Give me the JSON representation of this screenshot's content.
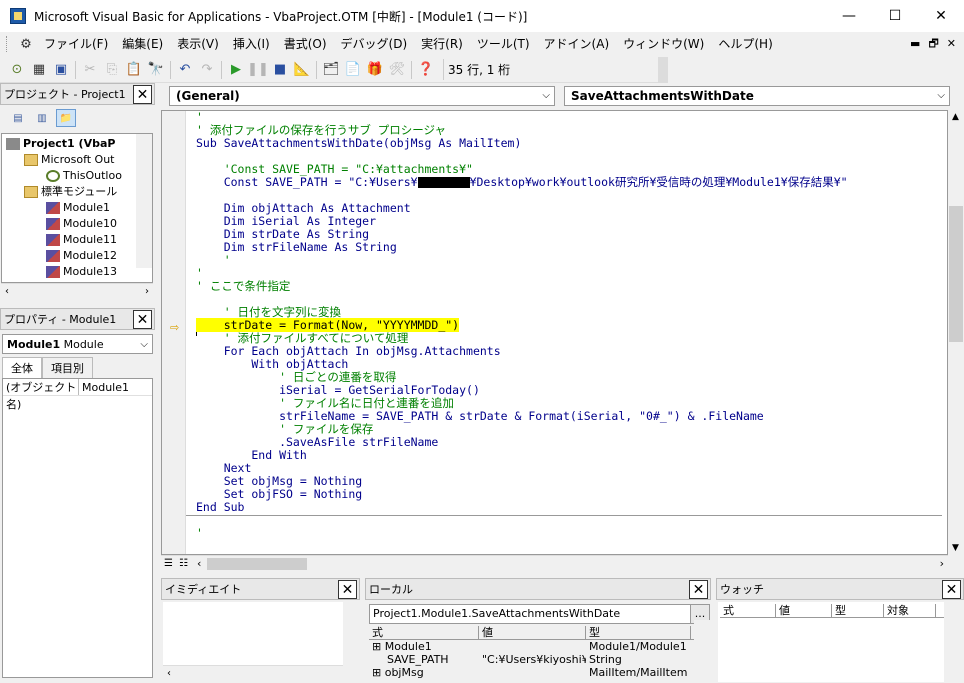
{
  "window": {
    "title": "Microsoft Visual Basic for Applications - VbaProject.OTM [中断] - [Module1 (コード)]",
    "min": "—",
    "max": "☐",
    "close": "✕"
  },
  "menu": [
    "ファイル(F)",
    "編集(E)",
    "表示(V)",
    "挿入(I)",
    "書式(O)",
    "デバッグ(D)",
    "実行(R)",
    "ツール(T)",
    "アドイン(A)",
    "ウィンドウ(W)",
    "ヘルプ(H)"
  ],
  "mdi": {
    "min": "▬",
    "restore": "🗗",
    "close": "✕"
  },
  "toolbar": {
    "position": "35 行, 1 桁"
  },
  "project": {
    "title": "プロジェクト - Project1",
    "tree": [
      "Project1 (VbaP",
      "Microsoft Out",
      "ThisOutloo",
      "標準モジュール",
      "Module1",
      "Module10",
      "Module11",
      "Module12",
      "Module13"
    ]
  },
  "properties": {
    "title": "プロパティ - Module1",
    "object": "Module1",
    "object_type": "Module",
    "tabs": [
      "全体",
      "項目別"
    ],
    "rows": [
      {
        "name": "(オブジェクト名)",
        "value": "Module1"
      }
    ]
  },
  "code": {
    "object_combo": "(General)",
    "proc_combo": "SaveAttachmentsWithDate",
    "lines": [
      {
        "t": "'",
        "c": "cm"
      },
      {
        "t": "' 添付ファイルの保存を行うサブ プロシージャ",
        "c": "cm"
      },
      {
        "t": "Sub SaveAttachmentsWithDate(objMsg As MailItem)",
        "c": "kw"
      },
      {
        "t": "",
        "c": ""
      },
      {
        "t": "    'Const SAVE_PATH = \"C:¥attachments¥\"",
        "c": "cm"
      },
      {
        "t": "    Const SAVE_PATH = \"C:¥Users¥",
        "c": "kw",
        "redact": true,
        "tail": "¥Desktop¥work¥outlook研究所¥受信時の処理¥Module1¥保存結果¥\""
      },
      {
        "t": "",
        "c": ""
      },
      {
        "t": "    Dim objAttach As Attachment",
        "c": "kw"
      },
      {
        "t": "    Dim iSerial As Integer",
        "c": "kw"
      },
      {
        "t": "    Dim strDate As String",
        "c": "kw"
      },
      {
        "t": "    Dim strFileName As String",
        "c": "kw"
      },
      {
        "t": "    '",
        "c": "cm"
      },
      {
        "t": "'",
        "c": "cm"
      },
      {
        "t": "' ここで条件指定",
        "c": "cm"
      },
      {
        "t": "",
        "c": ""
      },
      {
        "t": "    ' 日付を文字列に変換",
        "c": "cm"
      },
      {
        "t": "    strDate = Format(Now, \"YYYYMMDD_\")",
        "c": "hl"
      },
      {
        "t": "    ' 添付ファイルすべてについて処理",
        "c": "cm"
      },
      {
        "t": "    For Each objAttach In objMsg.Attachments",
        "c": "kw"
      },
      {
        "t": "        With objAttach",
        "c": "kw"
      },
      {
        "t": "            ' 日ごとの連番を取得",
        "c": "cm"
      },
      {
        "t": "            iSerial = GetSerialForToday()",
        "c": "kw"
      },
      {
        "t": "            ' ファイル名に日付と連番を追加",
        "c": "cm"
      },
      {
        "t": "            strFileName = SAVE_PATH & strDate & Format(iSerial, \"0#_\") & .FileName",
        "c": "kw"
      },
      {
        "t": "            ' ファイルを保存",
        "c": "cm"
      },
      {
        "t": "            .SaveAsFile strFileName",
        "c": "kw"
      },
      {
        "t": "        End With",
        "c": "kw"
      },
      {
        "t": "    Next",
        "c": "kw"
      },
      {
        "t": "    Set objMsg = Nothing",
        "c": "kw"
      },
      {
        "t": "    Set objFSO = Nothing",
        "c": "kw"
      },
      {
        "t": "End Sub",
        "c": "kw"
      },
      {
        "t": "",
        "c": ""
      },
      {
        "t": "'",
        "c": "cm"
      }
    ]
  },
  "immediate": {
    "title": "イミディエイト"
  },
  "locals": {
    "title": "ローカル",
    "context": "Project1.Module1.SaveAttachmentsWithDate",
    "context_btn": "...",
    "headers": [
      "式",
      "値",
      "型"
    ],
    "rows": [
      {
        "expr": "Module1",
        "value": "",
        "type": "Module1/Module1",
        "expand": "⊞"
      },
      {
        "expr": "SAVE_PATH",
        "value": "\"C:¥Users¥kiyoshi¥[",
        "type": "String",
        "expand": ""
      },
      {
        "expr": "objMsg",
        "value": "",
        "type": "MailItem/MailItem",
        "expand": "⊞"
      }
    ]
  },
  "watch": {
    "title": "ウォッチ",
    "headers": [
      "式",
      "値",
      "型",
      "対象"
    ]
  }
}
